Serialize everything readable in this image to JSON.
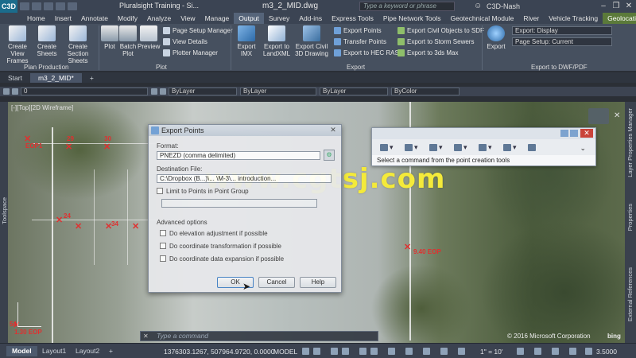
{
  "titlebar": {
    "app_logo": "C3D",
    "app_title": "Pluralsight Training - Si...",
    "document": "m3_2_MID.dwg",
    "search_placeholder": "Type a keyword or phrase",
    "user": "C3D-Nash"
  },
  "ribbon_tabs": [
    "Home",
    "Insert",
    "Annotate",
    "Modify",
    "Analyze",
    "View",
    "Manage",
    "Output",
    "Survey",
    "Add-ins",
    "Express Tools",
    "Pipe Network Tools",
    "Geotechnical Module",
    "River",
    "Vehicle Tracking",
    "Geolocation"
  ],
  "active_tab": "Output",
  "ribbon": {
    "plan_production": {
      "label": "Plan Production",
      "create_view_frames": "Create View Frames",
      "create_sheets": "Create Sheets",
      "create_section_sheets": "Create Section Sheets"
    },
    "plot": {
      "label": "Plot",
      "plot": "Plot",
      "batch_plot": "Batch Plot",
      "preview": "Preview",
      "page_setup_manager": "Page Setup Manager",
      "view_details": "View Details",
      "plotter_manager": "Plotter Manager"
    },
    "export": {
      "label": "Export",
      "export_imx": "Export IMX",
      "export_landxml": "Export to LandXML",
      "export_civil3d_drawing": "Export Civil 3D Drawing",
      "export_points": "Export Points",
      "transfer_points": "Transfer Points",
      "export_hec_ras": "Export to HEC RAS",
      "export_civil_objects_sdf": "Export Civil Objects to SDF",
      "export_storm_sewers": "Export to Storm Sewers",
      "export_3ds_max": "Export to 3ds Max"
    },
    "export_dwf": {
      "label": "Export to DWF/PDF",
      "export": "Export",
      "export_display": "Export: Display",
      "page_setup": "Page Setup: Current"
    }
  },
  "doc_tabs": [
    "Start",
    "m3_2_MID*"
  ],
  "toolbar": {
    "layer": "0",
    "color": "ByLayer",
    "linetype": "ByLayer",
    "lineweight": "ByLayer",
    "plotstyle": "ByColor"
  },
  "viewport": {
    "label": "[-][Top][2D Wireframe]",
    "points": [
      "EOP1",
      "29",
      "30",
      "9.40 EOP",
      "1.30 EOP",
      "1.40",
      "9.40",
      "24",
      "34",
      "54"
    ],
    "copyright": "© 2016 Microsoft Corporation",
    "bing": "bing"
  },
  "palettes": {
    "left": "Toolspace",
    "right_top": "Layer Properties Manager",
    "right_mid": "Properties",
    "right_bottom": "External References"
  },
  "export_points_dialog": {
    "title": "Export Points",
    "format_label": "Format:",
    "format_value": "PNEZD (comma delimited)",
    "destination_label": "Destination File:",
    "destination_value": "C:\\Dropbox (B...)\\... \\M-3\\... introduction...",
    "limit_label": "Limit to Points in Point Group",
    "advanced_label": "Advanced options",
    "opt_elevation": "Do elevation adjustment if possible",
    "opt_coord_transform": "Do coordinate transformation if possible",
    "opt_coord_expansion": "Do coordinate data expansion if possible",
    "ok": "OK",
    "cancel": "Cancel",
    "help": "Help"
  },
  "point_tools": {
    "status": "Select a command from the point creation tools"
  },
  "watermark": "www.cgtsj.com",
  "command_line": {
    "placeholder": "Type a command"
  },
  "status": {
    "layouts": [
      "Model",
      "Layout1",
      "Layout2"
    ],
    "coordinates": "1376303.1267, 507964.9720, 0.0000",
    "mode": "MODEL",
    "scale": "1\" = 10'",
    "zoom": "3.5000"
  },
  "colors": {
    "accent": "#556479",
    "point_markers": "#e03030",
    "watermark": "#f4ea3a"
  }
}
